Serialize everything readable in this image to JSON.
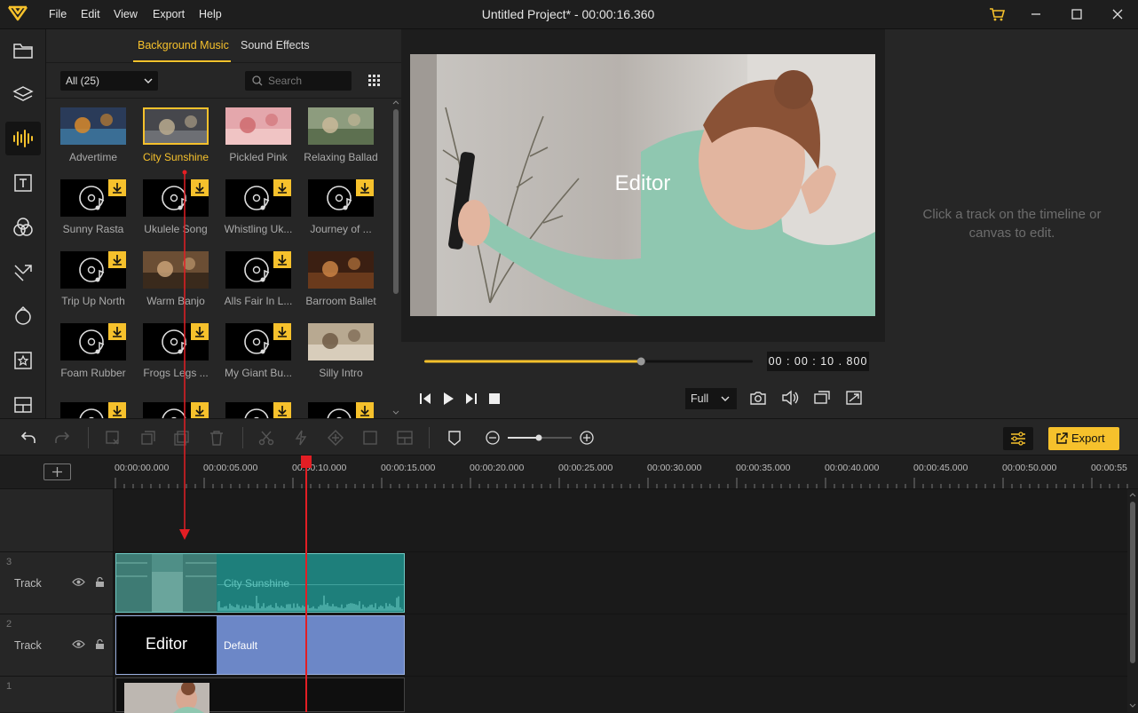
{
  "menu": [
    "File",
    "Edit",
    "View",
    "Export",
    "Help"
  ],
  "window_title": "Untitled Project* - 00:00:16.360",
  "sidebar_icons": [
    "media-icon",
    "layers-icon",
    "audio-icon",
    "text-icon",
    "filters-icon",
    "transitions-icon",
    "overlays-icon",
    "elements-icon",
    "templates-icon"
  ],
  "library": {
    "tabs": [
      "Background Music",
      "Sound Effects"
    ],
    "filter": "All (25)",
    "search_placeholder": "Search",
    "items": [
      {
        "label": "Advertime",
        "thumb": "photo",
        "selected": false
      },
      {
        "label": "City Sunshine",
        "thumb": "photo",
        "selected": true
      },
      {
        "label": "Pickled Pink",
        "thumb": "photo",
        "selected": false
      },
      {
        "label": "Relaxing Ballad",
        "thumb": "photo",
        "selected": false
      },
      {
        "label": "Sunny Rasta",
        "thumb": "music",
        "selected": false
      },
      {
        "label": "Ukulele Song",
        "thumb": "music",
        "selected": false
      },
      {
        "label": "Whistling Uk...",
        "thumb": "music",
        "selected": false
      },
      {
        "label": "Journey of ...",
        "thumb": "music",
        "selected": false
      },
      {
        "label": "Trip Up North",
        "thumb": "music",
        "selected": false
      },
      {
        "label": "Warm Banjo",
        "thumb": "photo",
        "selected": false
      },
      {
        "label": "Alls Fair In L...",
        "thumb": "music",
        "selected": false
      },
      {
        "label": "Barroom Ballet",
        "thumb": "photo",
        "selected": false
      },
      {
        "label": "Foam Rubber",
        "thumb": "music",
        "selected": false
      },
      {
        "label": "Frogs Legs ...",
        "thumb": "music",
        "selected": false
      },
      {
        "label": "My Giant Bu...",
        "thumb": "music",
        "selected": false
      },
      {
        "label": "Silly Intro",
        "thumb": "photo",
        "selected": false
      }
    ]
  },
  "preview": {
    "overlay_text": "Editor",
    "progress": 0.66,
    "timecode": "00 : 00 : 10 . 800",
    "zoom": "Full"
  },
  "properties": {
    "hint": "Click a track on the timeline or canvas to edit."
  },
  "toolbar": {
    "export_label": "Export"
  },
  "timeline": {
    "ticks": [
      "00:00:00.000",
      "00:00:05.000",
      "00:00:10.000",
      "00:00:15.000",
      "00:00:20.000",
      "00:00:25.000",
      "00:00:30.000",
      "00:00:35.000",
      "00:00:40.000",
      "00:00:45.000",
      "00:00:50.000",
      "00:00:55"
    ],
    "tracks": [
      {
        "number": "3",
        "label": "Track"
      },
      {
        "number": "2",
        "label": "Track"
      },
      {
        "number": "1",
        "label": ""
      }
    ],
    "clips": {
      "music_clip_label": "City Sunshine",
      "text_clip_thumb": "Editor",
      "text_clip_label": "Default"
    }
  },
  "colors": {
    "accent": "#f6c12c",
    "playhead": "#e31e24",
    "audio_clip": "#1e7f7b",
    "text_clip": "#6c87c7"
  }
}
